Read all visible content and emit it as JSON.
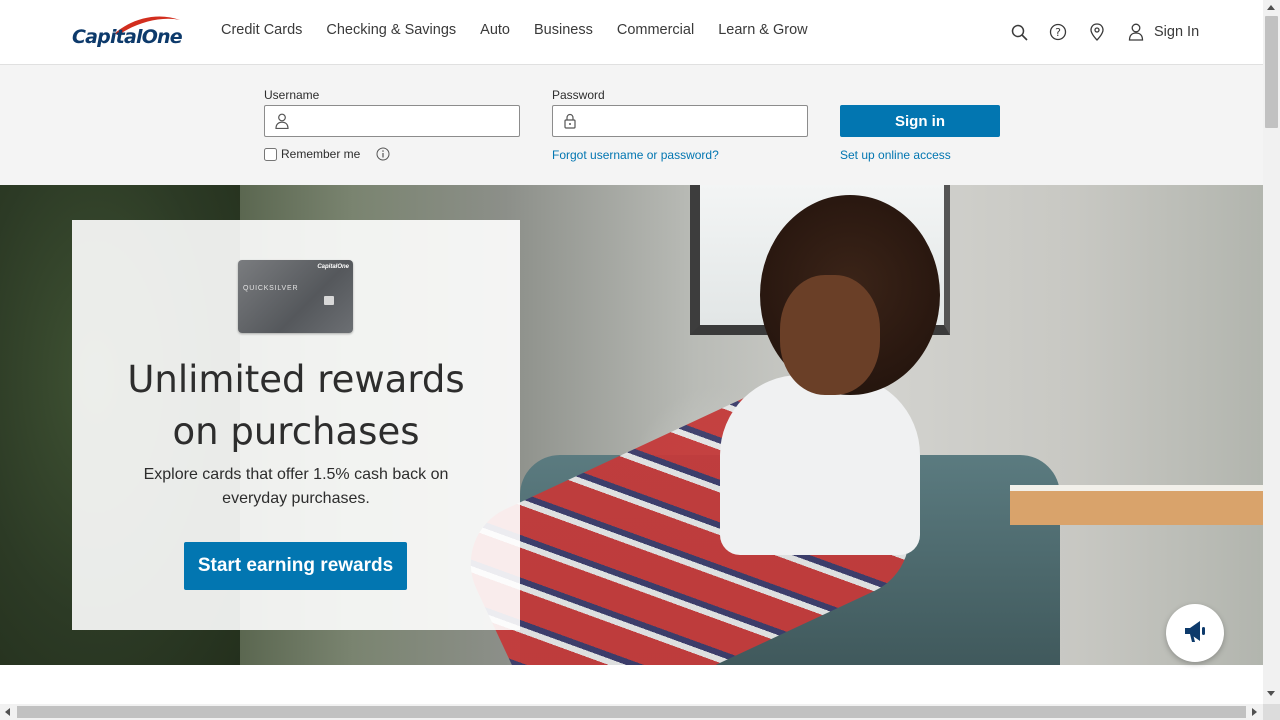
{
  "brand": {
    "logo_text": "CapitalOne",
    "logo_icon": "capital-one-swoosh-logo"
  },
  "nav": {
    "items": [
      {
        "label": "Credit Cards"
      },
      {
        "label": "Checking & Savings"
      },
      {
        "label": "Auto"
      },
      {
        "label": "Business"
      },
      {
        "label": "Commercial"
      },
      {
        "label": "Learn & Grow"
      }
    ]
  },
  "utility": {
    "icons": [
      "search-icon",
      "help-icon",
      "location-icon",
      "user-icon"
    ],
    "sign_in_label": "Sign In"
  },
  "login": {
    "username_label": "Username",
    "username_value": "",
    "password_label": "Password",
    "password_value": "",
    "sign_in_button": "Sign in",
    "remember_label": "Remember me",
    "remember_checked": false,
    "forgot_link": "Forgot username or password?",
    "setup_link": "Set up online access"
  },
  "promo": {
    "card_brand": "CapitalOne",
    "card_name": "QUICKSILVER",
    "heading_line1": "Unlimited rewards",
    "heading_line2": "on purchases",
    "subtext": "Explore cards that offer 1.5% cash back on everyday purchases.",
    "cta_label": "Start earning rewards"
  },
  "feedback": {
    "icon": "megaphone-icon"
  },
  "colors": {
    "primary": "#0276b1",
    "logo_navy": "#0d3a6b",
    "logo_red": "#d22e1e",
    "login_bar_bg": "#f4f4f4",
    "text": "#2d2d2d"
  }
}
